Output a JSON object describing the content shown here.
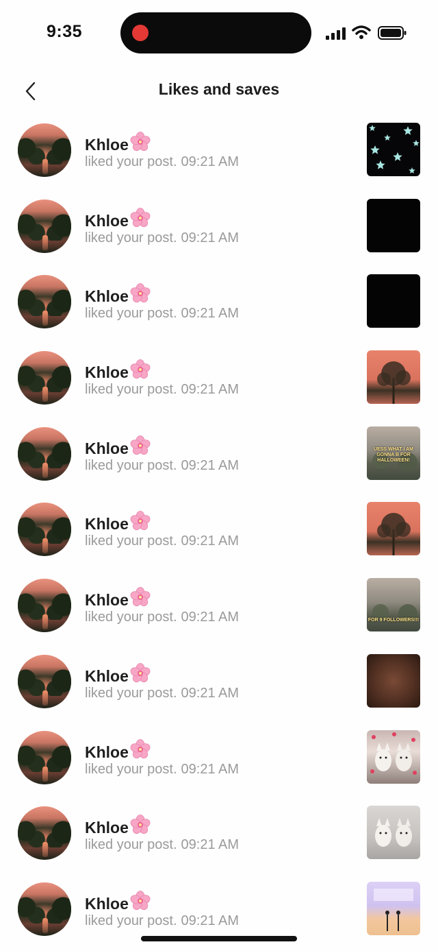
{
  "status_bar": {
    "time": "9:35"
  },
  "header": {
    "title": "Likes and saves",
    "back_icon": "chevron-left-icon"
  },
  "notifications": [
    {
      "name": "Khloe",
      "action": "liked your post.",
      "time": "09:21 AM",
      "thumb": {
        "style": "stars"
      }
    },
    {
      "name": "Khloe",
      "action": "liked your post.",
      "time": "09:21 AM",
      "thumb": {
        "style": "black"
      }
    },
    {
      "name": "Khloe",
      "action": "liked your post.",
      "time": "09:21 AM",
      "thumb": {
        "style": "black"
      }
    },
    {
      "name": "Khloe",
      "action": "liked your post.",
      "time": "09:21 AM",
      "thumb": {
        "style": "sunset"
      }
    },
    {
      "name": "Khloe",
      "action": "liked your post.",
      "time": "09:21 AM",
      "thumb": {
        "style": "grey",
        "caption": "UESS WHAT I AM GONNA B FOR HALLOWEEN!"
      }
    },
    {
      "name": "Khloe",
      "action": "liked your post.",
      "time": "09:21 AM",
      "thumb": {
        "style": "sunset"
      }
    },
    {
      "name": "Khloe",
      "action": "liked your post.",
      "time": "09:21 AM",
      "thumb": {
        "style": "grey",
        "caption": "FOR 9 FOLLOWERS!!!"
      }
    },
    {
      "name": "Khloe",
      "action": "liked your post.",
      "time": "09:21 AM",
      "thumb": {
        "style": "brown"
      }
    },
    {
      "name": "Khloe",
      "action": "liked your post.",
      "time": "09:21 AM",
      "thumb": {
        "style": "dogs-hearts"
      }
    },
    {
      "name": "Khloe",
      "action": "liked your post.",
      "time": "09:21 AM",
      "thumb": {
        "style": "dogs"
      }
    },
    {
      "name": "Khloe",
      "action": "liked your post.",
      "time": "09:21 AM",
      "thumb": {
        "style": "room"
      }
    }
  ],
  "colors": {
    "accent_name": "#1e1e1e",
    "secondary_text": "#9a9a9a",
    "record_dot": "#e53935"
  }
}
